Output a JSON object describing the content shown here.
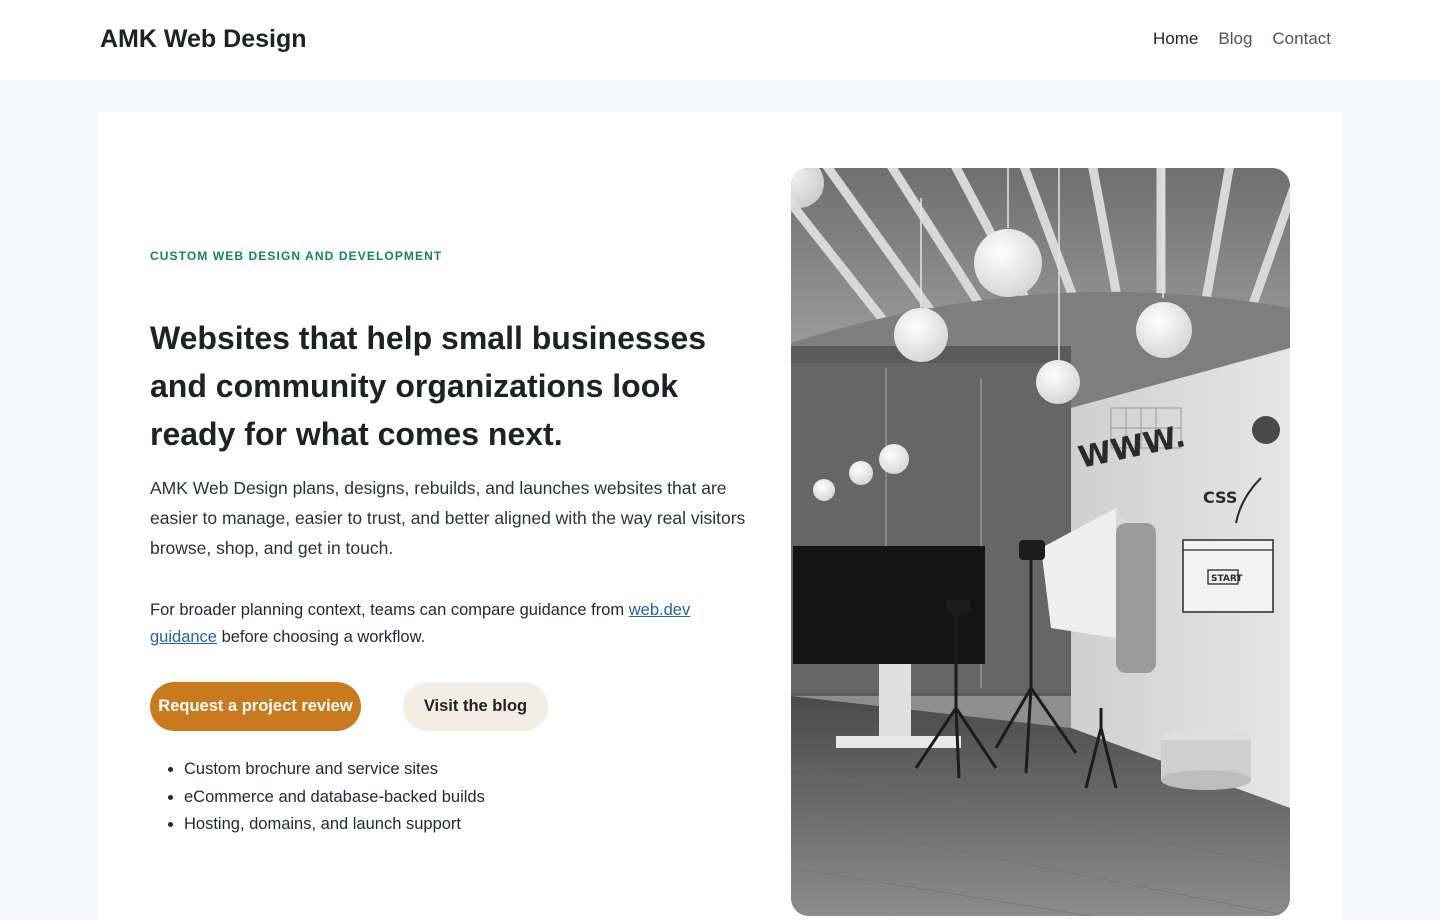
{
  "header": {
    "logo": "AMK Web Design",
    "nav": [
      {
        "label": "Home",
        "active": true
      },
      {
        "label": "Blog",
        "active": false
      },
      {
        "label": "Contact",
        "active": false
      }
    ]
  },
  "hero": {
    "eyebrow": "CUSTOM WEB DESIGN AND DEVELOPMENT",
    "headline": "Websites that help small businesses and community organizations look ready for what comes next.",
    "lede": "AMK Web Design plans, designs, rebuilds, and launches websites that are easier to manage, easier to trust, and better aligned with the way real visitors browse, shop, and get in touch.",
    "context_before": "For broader planning context, teams can compare guidance from ",
    "context_link": "web.dev guidance",
    "context_after": " before choosing a workflow.",
    "primary_cta": "Request a project review",
    "secondary_cta": "Visit the blog",
    "features": [
      "Custom brochure and service sites",
      "eCommerce and database-backed builds",
      "Hosting, domains, and launch support"
    ],
    "image": {
      "description_icon": "studio-photo-image",
      "wall_text": [
        "WWW.",
        "CSS",
        "START"
      ]
    }
  },
  "colors": {
    "accent": "#c97a1e",
    "eyebrow": "#14806b",
    "link": "#2563a8",
    "secondary_button": "#f3ede4",
    "page_bg": "#f5f8fa"
  }
}
